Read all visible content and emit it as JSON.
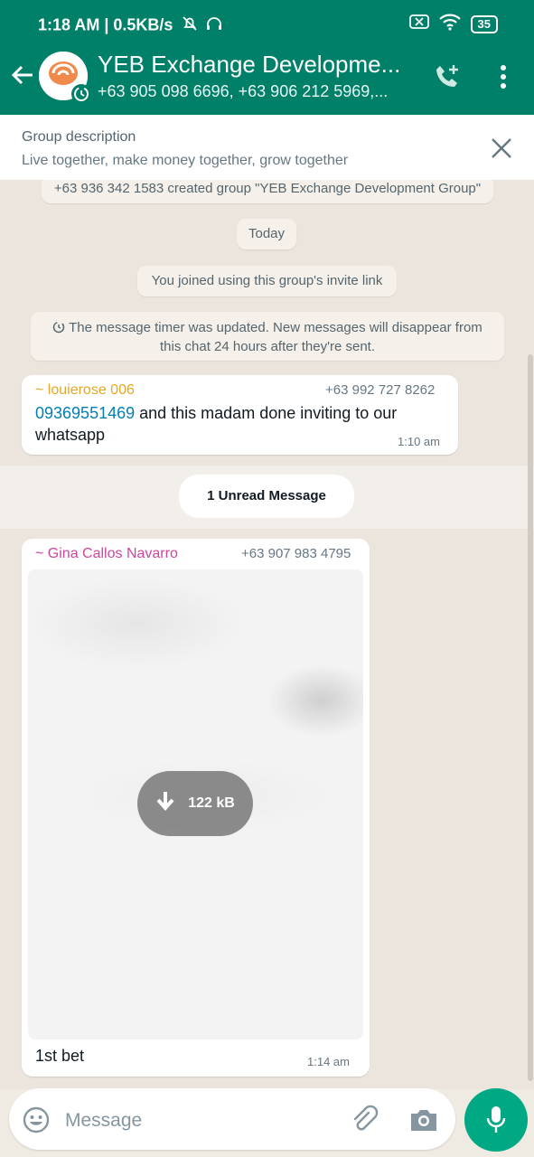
{
  "status_bar": {
    "time_speed": "1:18 AM | 0.5KB/s",
    "battery": "35"
  },
  "header": {
    "title": "YEB Exchange Developme...",
    "subtitle": "+63 905 098 6696, +63 906 212 5969,..."
  },
  "description": {
    "label": "Group description",
    "text": "Live together, make money together, grow together"
  },
  "chat": {
    "created_notice": "+63 936 342 1583 created group \"YEB Exchange Development Group\"",
    "date_chip": "Today",
    "joined_notice": "You joined using this group's invite link",
    "timer_notice_line1": "The message timer was updated. New messages will disappear from",
    "timer_notice_line2": "this chat 24 hours after they're sent.",
    "msg1": {
      "sender": "~ louierose 006",
      "phone": "+63 992 727 8262",
      "link": "09369551469",
      "text": " and this madam done inviting to our whatsapp",
      "time": "1:10 am"
    },
    "unread_label": "1 Unread Message",
    "msg2": {
      "sender": "~ Gina Callos Navarro",
      "phone": "+63 907 983 4795",
      "download_size": "122 kB",
      "caption": "1st bet",
      "time": "1:14 am"
    }
  },
  "input": {
    "placeholder": "Message"
  },
  "colors": {
    "brand_green": "#008069",
    "mic_green": "#00a884",
    "sender1": "#e5a823",
    "sender2": "#d0449c",
    "link": "#027eb5"
  },
  "icons": [
    "back-arrow-icon",
    "avatar",
    "add-call-icon",
    "more-vert-icon",
    "close-icon",
    "timer-icon",
    "download-icon",
    "emoji-icon",
    "attach-icon",
    "camera-icon",
    "mic-icon",
    "wifi-icon",
    "battery-icon",
    "bell-off-icon",
    "headphones-icon"
  ]
}
